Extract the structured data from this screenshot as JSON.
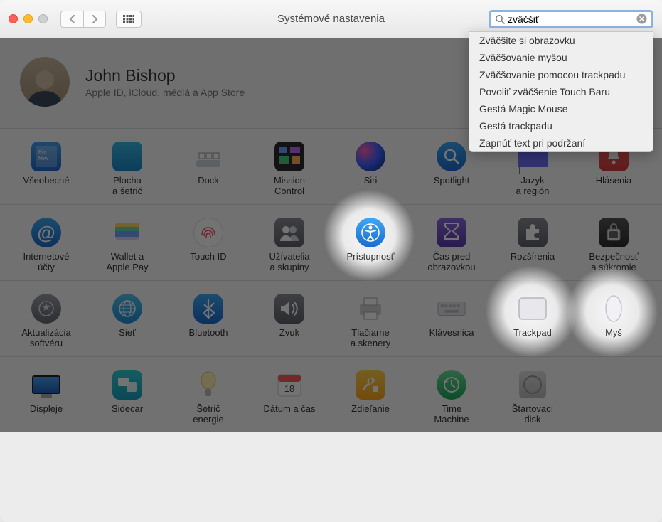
{
  "window": {
    "title": "Systémové nastavenia"
  },
  "search": {
    "value": "zväčšiť",
    "placeholder": ""
  },
  "suggestions": [
    "Zväčšite si obrazovku",
    "Zväčšovanie myšou",
    "Zväčšovanie pomocou trackpadu",
    "Povoliť zväčšenie Touch Baru",
    "Gestá Magic Mouse",
    "Gestá trackpadu",
    "Zapnúť text pri podržaní"
  ],
  "user": {
    "name": "John Bishop",
    "subtitle": "Apple ID, iCloud, médiá a App Store"
  },
  "rows": [
    [
      {
        "id": "general",
        "label": "Všeobecné"
      },
      {
        "id": "desktop",
        "label": "Plocha\na šetrič"
      },
      {
        "id": "dock",
        "label": "Dock"
      },
      {
        "id": "mission",
        "label": "Mission\nControl"
      },
      {
        "id": "siri",
        "label": "Siri"
      },
      {
        "id": "spotlight",
        "label": "Spotlight"
      },
      {
        "id": "language",
        "label": "Jazyk\na región"
      },
      {
        "id": "notifications",
        "label": "Hlásenia"
      }
    ],
    [
      {
        "id": "internet-accts",
        "label": "Internetové\núčty"
      },
      {
        "id": "wallet",
        "label": "Wallet a\nApple Pay"
      },
      {
        "id": "touchid",
        "label": "Touch ID"
      },
      {
        "id": "users",
        "label": "Užívatelia\na skupiny"
      },
      {
        "id": "accessibility",
        "label": "Prístupnosť",
        "highlight": true
      },
      {
        "id": "screentime",
        "label": "Čas pred\nobrazovkou"
      },
      {
        "id": "extensions",
        "label": "Rozšírenia"
      },
      {
        "id": "security",
        "label": "Bezpečnosť\na súkromie"
      }
    ],
    [
      {
        "id": "swupdate",
        "label": "Aktualizácia\nsoftvéru"
      },
      {
        "id": "network",
        "label": "Sieť"
      },
      {
        "id": "bluetooth",
        "label": "Bluetooth"
      },
      {
        "id": "sound",
        "label": "Zvuk"
      },
      {
        "id": "printers",
        "label": "Tlačiarne\na skenery"
      },
      {
        "id": "keyboard",
        "label": "Klávesnica"
      },
      {
        "id": "trackpad",
        "label": "Trackpad",
        "highlight": true
      },
      {
        "id": "mouse",
        "label": "Myš",
        "highlight": true
      }
    ],
    [
      {
        "id": "displays",
        "label": "Displeje"
      },
      {
        "id": "sidecar",
        "label": "Sidecar"
      },
      {
        "id": "energy",
        "label": "Šetrič\nenergie"
      },
      {
        "id": "datetime",
        "label": "Dátum a čas"
      },
      {
        "id": "sharing",
        "label": "Zdieľanie"
      },
      {
        "id": "timemachine",
        "label": "Time\nMachine"
      },
      {
        "id": "startupdisk",
        "label": "Štartovací\ndisk"
      }
    ]
  ]
}
